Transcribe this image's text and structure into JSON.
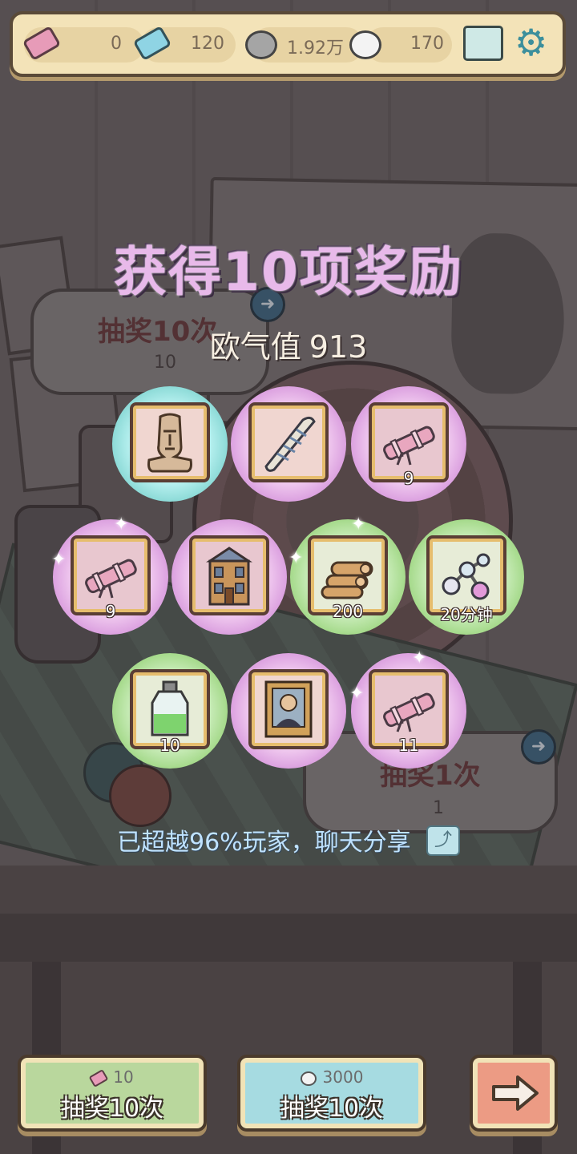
{
  "topbar": {
    "ticket_pink": "0",
    "ticket_blue": "120",
    "bubble_grey": "1.92万",
    "bubble_white": "170"
  },
  "background": {
    "left_bubble_title": "抽奖10次",
    "left_bubble_cost": "10",
    "right_bubble_title": "抽奖1次",
    "right_bubble_cost": "1"
  },
  "reward": {
    "title": "获得10项奖励",
    "luck_label": "欧气值",
    "luck_value": "913",
    "items": [
      {
        "name": "moai-statue",
        "rarity": "cyan",
        "qty": ""
      },
      {
        "name": "bandaged-bat",
        "rarity": "purple",
        "qty": ""
      },
      {
        "name": "telescope",
        "rarity": "purple",
        "qty": "9"
      },
      {
        "name": "telescope",
        "rarity": "purple",
        "qty": "9"
      },
      {
        "name": "wooden-building",
        "rarity": "purple",
        "qty": ""
      },
      {
        "name": "logs",
        "rarity": "green",
        "qty": "200"
      },
      {
        "name": "molecule",
        "rarity": "green",
        "qty": "20分钟"
      },
      {
        "name": "potion-bottle",
        "rarity": "green",
        "qty": "10"
      },
      {
        "name": "portrait",
        "rarity": "purple",
        "qty": ""
      },
      {
        "name": "telescope",
        "rarity": "purple",
        "qty": "11"
      }
    ]
  },
  "share": {
    "text": "已超越96%玩家，聊天分享"
  },
  "buttons": {
    "draw_ticket": {
      "cost": "10",
      "label": "抽奖10次"
    },
    "draw_bubble": {
      "cost": "3000",
      "label": "抽奖10次"
    }
  },
  "colors": {
    "title": "#e8b9ea",
    "rarity_cyan": "#8edbd8",
    "rarity_purple": "#dca2e0",
    "rarity_green": "#a6da8c"
  }
}
